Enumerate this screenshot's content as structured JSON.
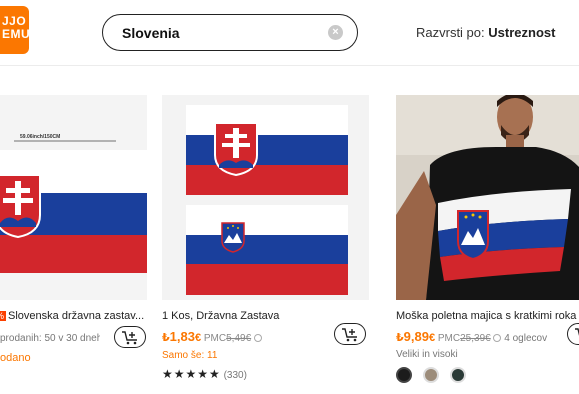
{
  "header": {
    "logo_line1": "JJO",
    "logo_line2": "EMU",
    "search_value": "Slovenia",
    "sort_label": "Razvrsti po:",
    "sort_value": "Ustreznost"
  },
  "products": [
    {
      "badge": "%",
      "title": "Slovenska državna zastav...",
      "sold": "prodanih: 50 v 30 dneh.",
      "status": "odano",
      "flag_label": "59.06inch/150CM"
    },
    {
      "title": "1 Kos, Državna Zastava",
      "price_sign": "₺",
      "price": "1,83",
      "currency": "€",
      "rrp_label": "PMC",
      "rrp_value": "5,49€",
      "stock": "Samo še: 11",
      "stars": "★★★★★",
      "reviews": "(330)"
    },
    {
      "title": "Moška poletna majica s kratkimi roka",
      "price_sign": "₺",
      "price": "9,89",
      "currency": "€",
      "rrp_label": "PMC",
      "rrp_value": "25,39€",
      "reviews_count": "4 oglecov",
      "size_note": "Veliki in visoki",
      "swatch_colors": [
        "#1c1c1c",
        "#9c8c7a",
        "#2a3a36"
      ]
    }
  ],
  "colors": {
    "accent": "#fb7701",
    "flag_white": "#ffffff",
    "flag_blue": "#1a3f9c",
    "flag_red": "#d2262c"
  }
}
